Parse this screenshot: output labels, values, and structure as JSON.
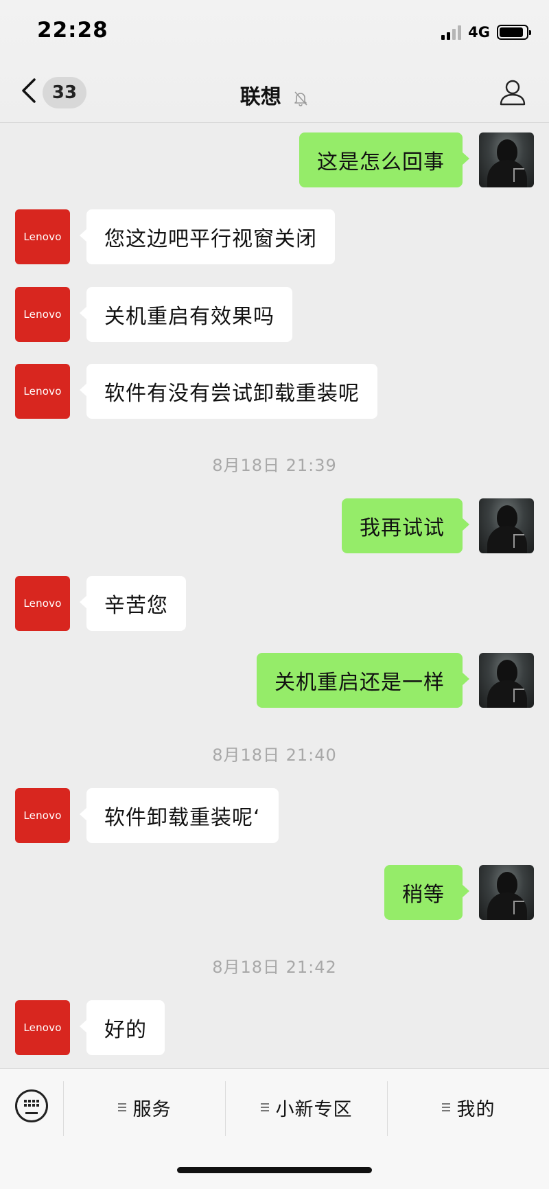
{
  "status_bar": {
    "time": "22:28",
    "network": "4G",
    "battery_percent": 90
  },
  "header": {
    "back_icon": "chevron-left-icon",
    "unread_count": "33",
    "title": "联想",
    "mute_icon": "bell-slash-icon",
    "profile_icon": "person-icon"
  },
  "messages": [
    {
      "from": "me",
      "text": "这是怎么回事"
    },
    {
      "from": "lenovo",
      "avatar_text": "Lenovo",
      "text": "您这边吧平行视窗关闭"
    },
    {
      "from": "lenovo",
      "avatar_text": "Lenovo",
      "text": "关机重启有效果吗"
    },
    {
      "from": "lenovo",
      "avatar_text": "Lenovo",
      "text": "软件有没有尝试卸载重装呢"
    },
    {
      "timestamp": "8月18日 21:39"
    },
    {
      "from": "me",
      "text": "我再试试"
    },
    {
      "from": "lenovo",
      "avatar_text": "Lenovo",
      "text": "辛苦您"
    },
    {
      "from": "me",
      "text": "关机重启还是一样"
    },
    {
      "timestamp": "8月18日 21:40"
    },
    {
      "from": "lenovo",
      "avatar_text": "Lenovo",
      "text": "软件卸载重装呢‘"
    },
    {
      "from": "me",
      "text": "稍等"
    },
    {
      "timestamp": "8月18日 21:42"
    },
    {
      "from": "lenovo",
      "avatar_text": "Lenovo",
      "text": "好的"
    }
  ],
  "bottom_menu": {
    "keyboard_icon": "keyboard-icon",
    "items": [
      "服务",
      "小新专区",
      "我的"
    ]
  },
  "colors": {
    "outgoing_bubble": "#95ec69",
    "incoming_bubble": "#ffffff",
    "brand_red": "#d8261f",
    "background": "#ededed"
  }
}
